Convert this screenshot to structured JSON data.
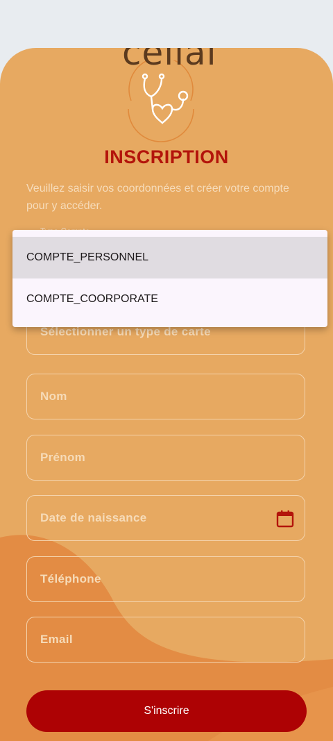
{
  "brand": {
    "logo_text": "cellal"
  },
  "header": {
    "title": "INSCRIPTION",
    "subtitle": "Veuillez saisir vos coordonnées et créer votre compte pour y accéder."
  },
  "form": {
    "account_type_label": "Type Compte",
    "card_type_placeholder": "Sélectionner un type de carte",
    "nom_placeholder": "Nom",
    "prenom_placeholder": "Prénom",
    "birthdate_placeholder": "Date de naissance",
    "phone_placeholder": "Téléphone",
    "email_placeholder": "Email",
    "submit_label": "S'inscrire"
  },
  "dropdown": {
    "options": [
      "COMPTE_PERSONNEL",
      "COMPTE_COORPORATE"
    ],
    "highlighted": "COMPTE_PERSONNEL"
  },
  "icons": {
    "date_picker": "calendar-icon",
    "logo_emblem": "stethoscope-heart-icon"
  },
  "colors": {
    "background": "#e7a961",
    "accent": "#b3140b",
    "button": "#ad0204",
    "field_border": "#f4d3ac"
  }
}
